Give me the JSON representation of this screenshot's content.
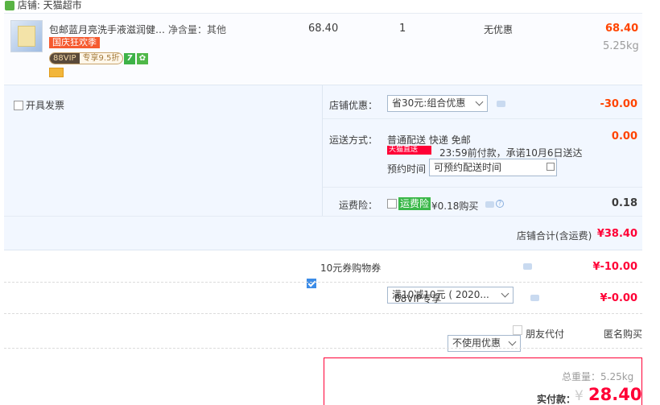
{
  "shop": {
    "label": "店铺: 天猫超市"
  },
  "item": {
    "title": "包邮蓝月亮洗手液滋润健康...",
    "spec": "净含量：其他",
    "promo_badge": "国庆狂欢季",
    "vip_left": "88VIP",
    "vip_right": "专享9.5折",
    "icon_seven": "7",
    "price": "68.40",
    "quantity": "1",
    "discount": "无优惠",
    "total": "68.40",
    "weight": "5.25kg"
  },
  "options": {
    "invoice_label": "开具发票",
    "shop_discount_label": "店铺优惠：",
    "shop_discount_value": "省30元:组合优惠",
    "shop_discount_amount": "-30.00",
    "delivery_label": "运送方式：",
    "delivery_method": "普通配送 快递 免邮",
    "delivery_fee": "0.00",
    "tmall_logo": "天猫直送",
    "delivery_promise": "23:59前付款，承诺10月6日送达",
    "appointment_label": "预约时间",
    "appointment_placeholder": "可预约配送时间",
    "insurance_label": "运费险：",
    "insurance_badge": "运费险",
    "insurance_price": "¥0.18购买",
    "insurance_amount": "0.18",
    "shop_total_label": "店铺合计(含运费)",
    "shop_total_value": "¥38.40"
  },
  "coupon": {
    "label": "10元券购物券",
    "value": "满10减10元 ( 2020...",
    "amount": "¥-10.00"
  },
  "vip": {
    "label": "88VIP专享",
    "value": "不使用优惠",
    "amount": "¥-0.00"
  },
  "pay_options": {
    "friend_pay": "朋友代付",
    "anonymous": "匿名购买"
  },
  "checkout": {
    "weight_label": "总重量：5.25kg",
    "paid_label": "实付款：",
    "currency": "¥",
    "paid_value": "28.40"
  },
  "colors": {
    "accent_red": "#ff0036",
    "price_orange": "#ff4400",
    "link_blue": "#3c8ce7",
    "panel_bg": "#f2f7ff"
  }
}
